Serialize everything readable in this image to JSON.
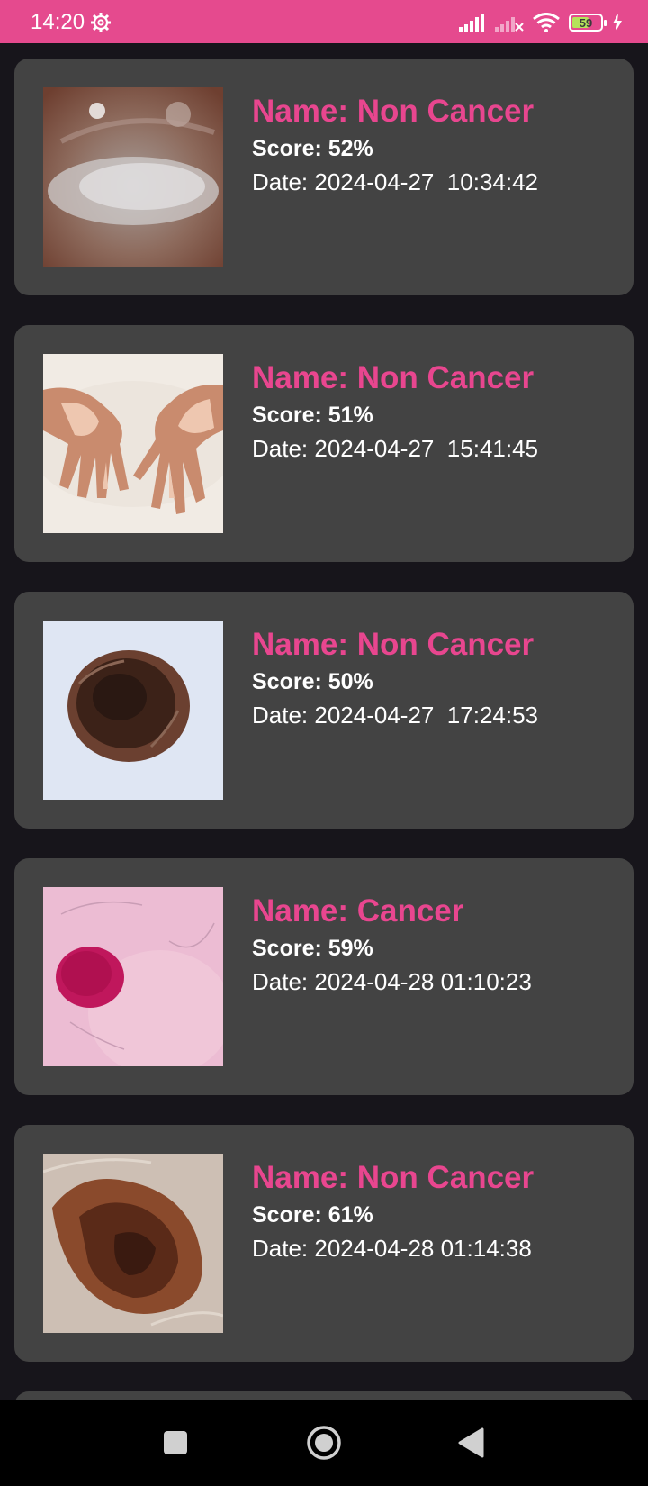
{
  "status_bar": {
    "time": "14:20",
    "battery_level": "59",
    "battery_fraction": 0.59,
    "icons": [
      "gear-icon",
      "signal-icon",
      "no-signal-icon",
      "wifi-icon",
      "battery-icon",
      "charging-icon"
    ]
  },
  "colors": {
    "accent": "#e54a8e",
    "name_text": "#e8468f",
    "card": "#434343",
    "background": "#17151b"
  },
  "results": [
    {
      "name": "Name: Non Cancer",
      "score": "Score: 52%",
      "date": "Date: 2024-04-27  10:34:42",
      "image": "skin-lesion-photo-1"
    },
    {
      "name": "Name: Non Cancer",
      "score": "Score: 51%",
      "date": "Date: 2024-04-27  15:41:45",
      "image": "hands-vitiligo-photo"
    },
    {
      "name": "Name: Non Cancer",
      "score": "Score: 50%",
      "date": "Date: 2024-04-27  17:24:53",
      "image": "mole-photo"
    },
    {
      "name": "Name: Cancer",
      "score": "Score: 59%",
      "date": "Date: 2024-04-28 01:10:23",
      "image": "pink-lesion-photo"
    },
    {
      "name": "Name: Non Cancer",
      "score": "Score: 61%",
      "date": "Date: 2024-04-28 01:14:38",
      "image": "melanoma-photo"
    }
  ],
  "nav": [
    "recents-button",
    "home-button",
    "back-button"
  ]
}
